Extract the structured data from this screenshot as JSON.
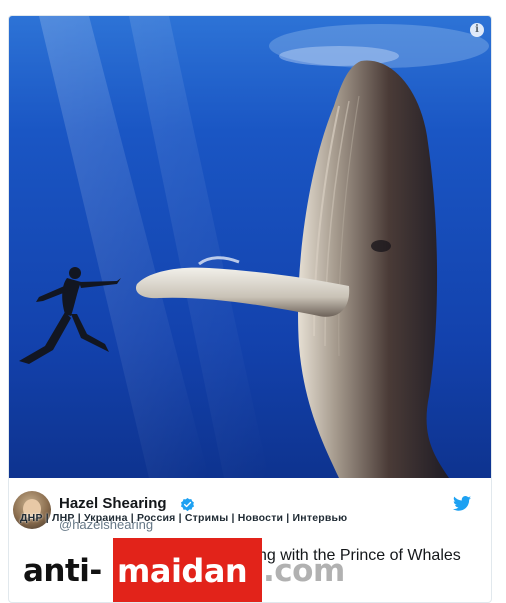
{
  "tweet": {
    "display_name": "Hazel Shearing",
    "handle": "@hazelshearing",
    "text_fragment": "ng with the Prince of Whales"
  },
  "overlay_nav": {
    "text": "ДНР | ЛНР | Украина | Россия | Стримы | Новости | Интервью"
  },
  "watermark": {
    "part1": "anti-",
    "part2": "maidan",
    "part3": ".com"
  },
  "icons": {
    "info": "info-icon",
    "verified": "verified-badge-icon",
    "twitter": "twitter-bird-icon"
  },
  "colors": {
    "water": "#1446b8",
    "twitter_blue": "#1da1f2",
    "watermark_red": "#e2231a"
  }
}
